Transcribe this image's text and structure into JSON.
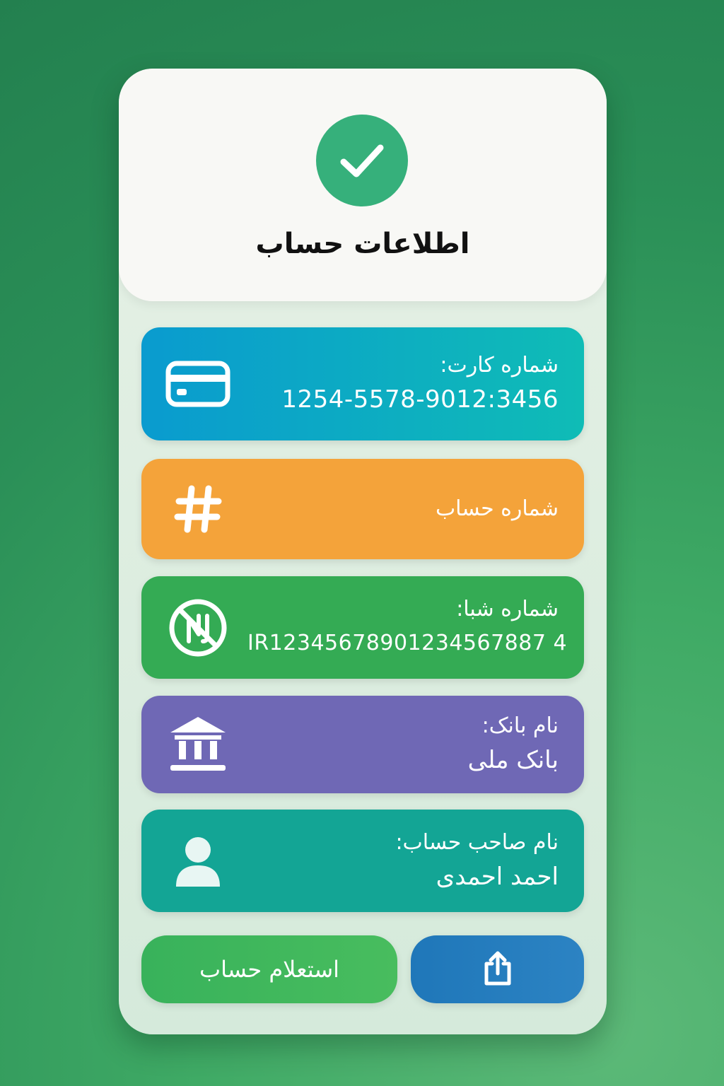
{
  "header": {
    "title": "اطلاعات حساب",
    "check_icon": "check-circle-icon"
  },
  "rows": [
    {
      "label": "شماره کارت:",
      "value": "1254-5578-9012:3456",
      "icon": "credit-card-icon",
      "color_from": "#0a9bcf",
      "color_to": "#0fbcb6"
    },
    {
      "label": "شماره حساب",
      "icon": "hash-icon",
      "color": "#f4a33a"
    },
    {
      "label": "شماره شبا:",
      "value": "IR12345678901234567887 4",
      "icon": "sheba-icon",
      "color": "#34ab54"
    },
    {
      "label": "نام بانک:",
      "value": "بانک ملی",
      "icon": "bank-icon",
      "color": "#6f68b5"
    },
    {
      "label": "نام صاحب حساب:",
      "value": "احمد احمدی",
      "icon": "user-icon",
      "color": "#13a595"
    }
  ],
  "buttons": {
    "inquiry_label": "استعلام حساب",
    "share_icon": "share-icon",
    "inquiry_color": "#3db45d",
    "share_color": "#2580c0"
  }
}
